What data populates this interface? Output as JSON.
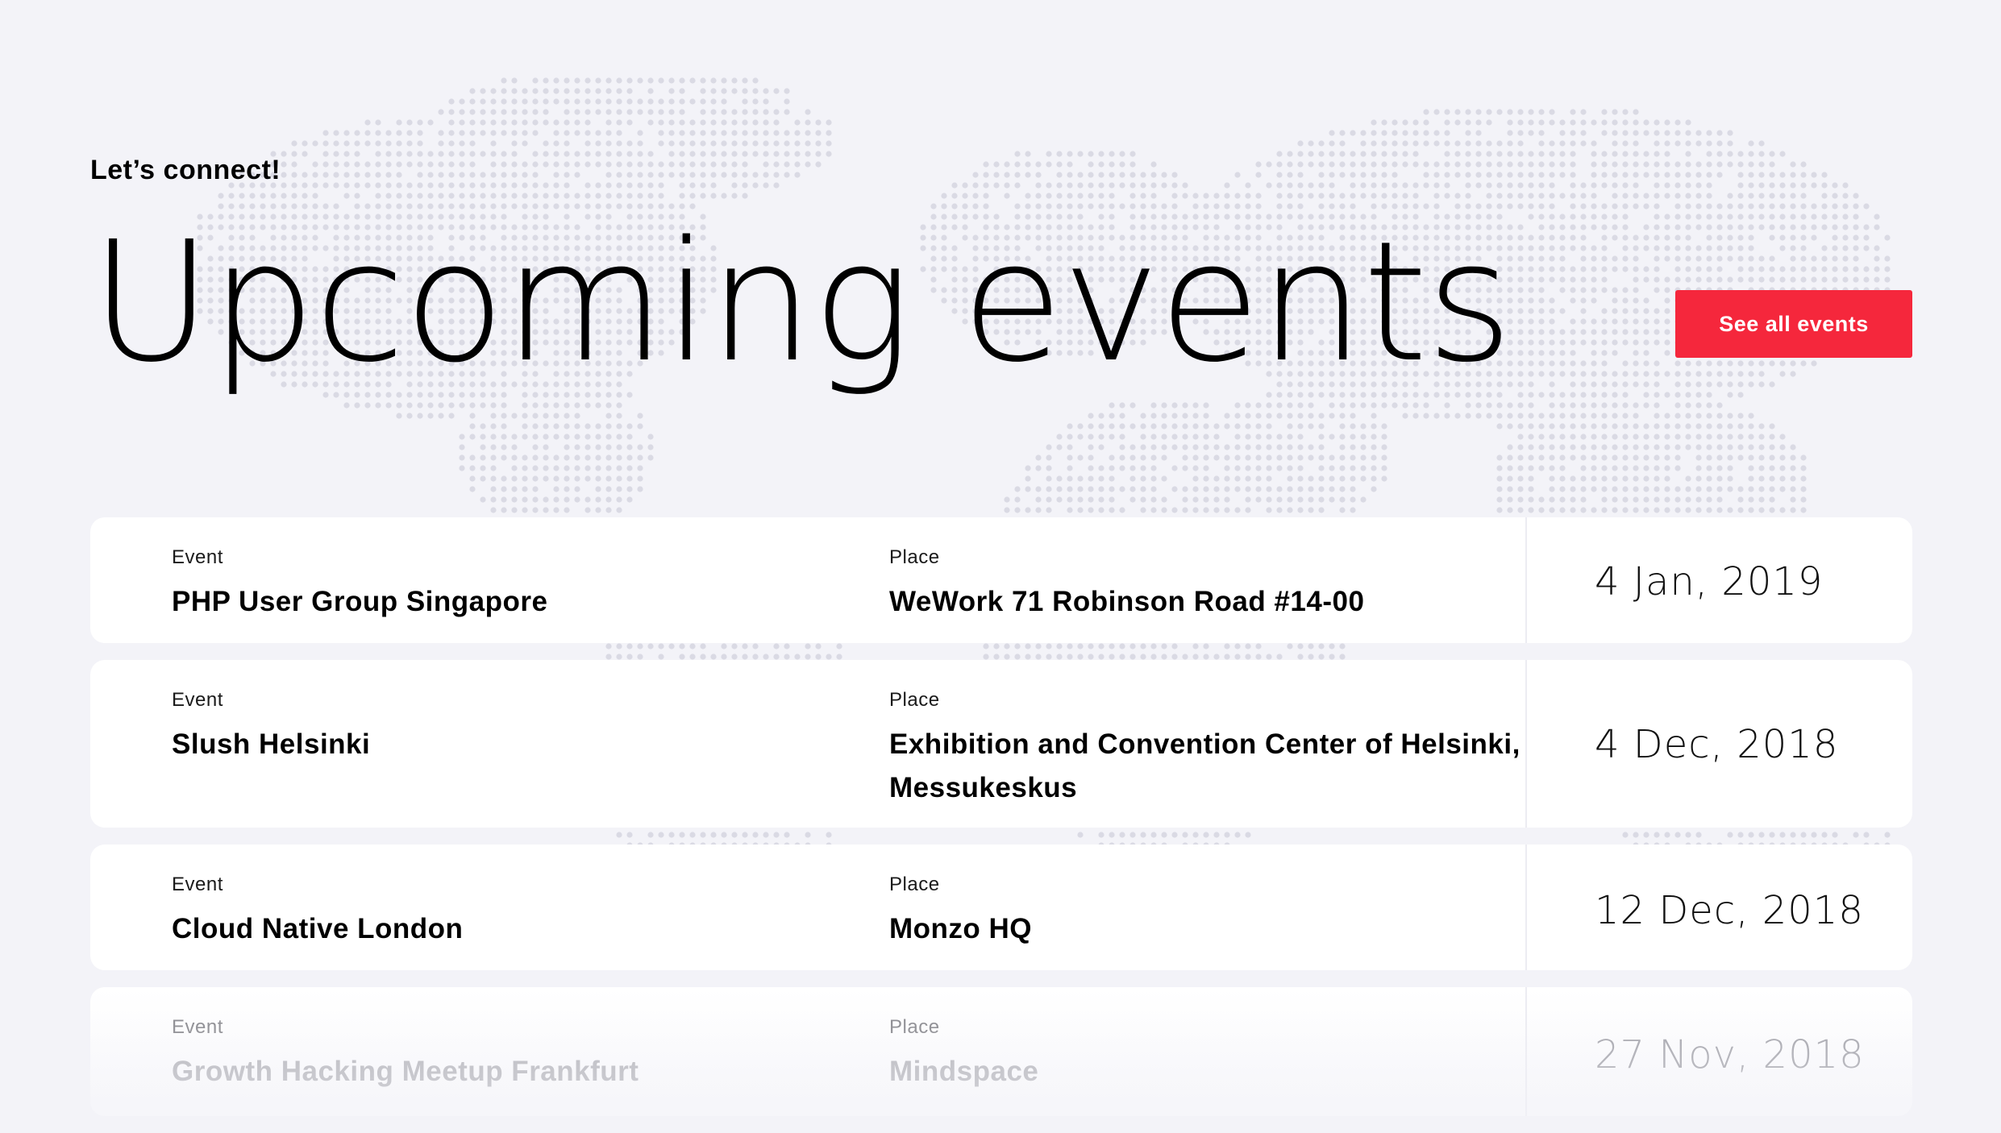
{
  "header": {
    "eyebrow": "Let’s connect!",
    "title": "Upcoming events",
    "cta_label": "See all events"
  },
  "colors": {
    "accent": "#f5273c",
    "background": "#f3f3f8",
    "map_dots": "#dadae4",
    "card": "#ffffff"
  },
  "columns": {
    "event": "Event",
    "place": "Place"
  },
  "events": [
    {
      "name": "PHP User Group Singapore",
      "place": "WeWork 71 Robinson Road #14-00",
      "date": "4 Jan, 2019"
    },
    {
      "name": "Slush Helsinki",
      "place": "Exhibition and Convention Center of Helsinki, Messukeskus",
      "date": "4 Dec, 2018"
    },
    {
      "name": "Cloud Native London",
      "place": "Monzo HQ",
      "date": "12 Dec, 2018"
    },
    {
      "name": "Growth Hacking Meetup Frankfurt",
      "place": "Mindspace",
      "date": "27 Nov, 2018"
    }
  ],
  "background_graphic": "dotted-world-map"
}
